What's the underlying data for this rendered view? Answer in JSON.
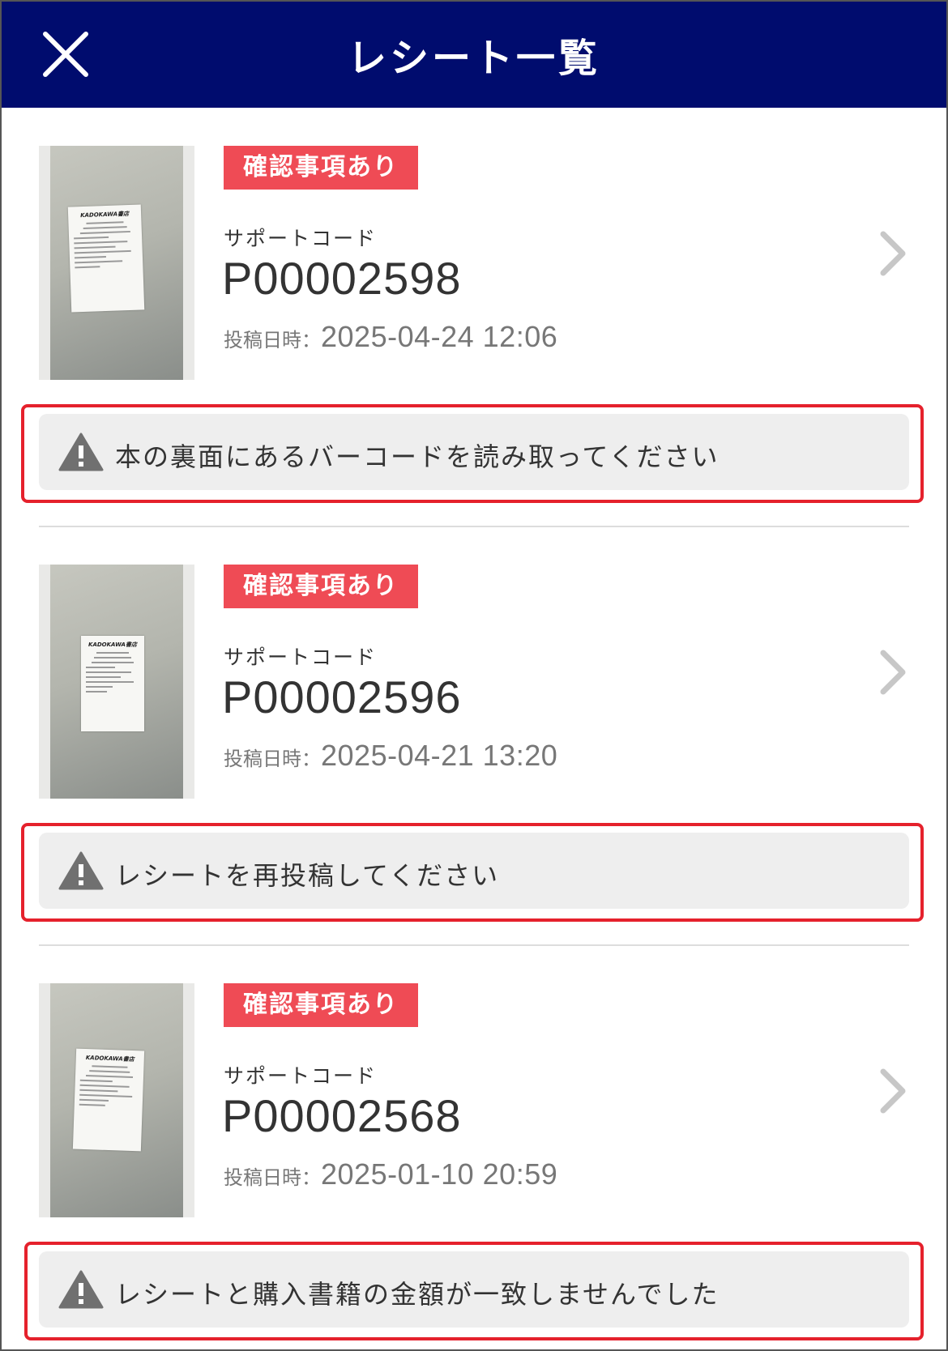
{
  "header": {
    "title": "レシート一覧",
    "close_icon": "close-icon",
    "background": "#000c6e"
  },
  "colors": {
    "badge": "#ef4b55",
    "highlight_border": "#e5212c",
    "message_bg": "#eeeeee"
  },
  "receipts": [
    {
      "badge": "確認事項あり",
      "support_label": "サポートコード",
      "code": "P00002598",
      "date_label": "投稿日時：",
      "date": "2025-04-24 12:06",
      "message": "本の裏面にあるバーコードを読み取ってください",
      "thumbnail_text": "KADOKAWA書店"
    },
    {
      "badge": "確認事項あり",
      "support_label": "サポートコード",
      "code": "P00002596",
      "date_label": "投稿日時：",
      "date": "2025-04-21 13:20",
      "message": "レシートを再投稿してください",
      "thumbnail_text": "KADOKAWA書店"
    },
    {
      "badge": "確認事項あり",
      "support_label": "サポートコード",
      "code": "P00002568",
      "date_label": "投稿日時：",
      "date": "2025-01-10 20:59",
      "message": "レシートと購入書籍の金額が一致しませんでした",
      "thumbnail_text": "KADOKAWA書店"
    }
  ]
}
